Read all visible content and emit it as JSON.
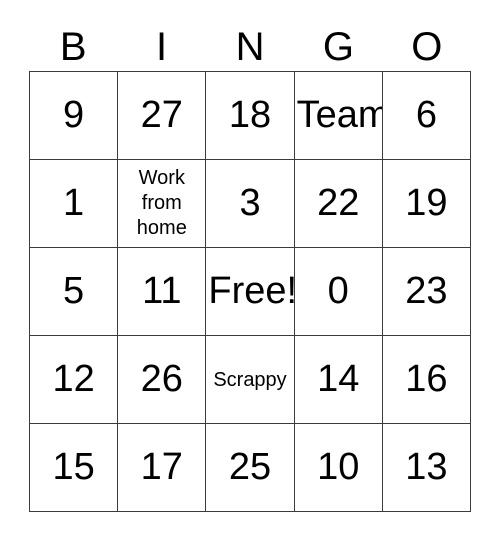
{
  "card": {
    "title": "BINGO",
    "headers": [
      "B",
      "I",
      "N",
      "G",
      "O"
    ],
    "free_space_label": "Free!",
    "colors": {
      "border": "#3b3b3b",
      "text": "#000000",
      "background": "#ffffff"
    },
    "rows": [
      [
        {
          "text": "9",
          "size": "large"
        },
        {
          "text": "27",
          "size": "large"
        },
        {
          "text": "18",
          "size": "large"
        },
        {
          "text": "Team",
          "size": "large"
        },
        {
          "text": "6",
          "size": "large"
        }
      ],
      [
        {
          "text": "1",
          "size": "large"
        },
        {
          "text": "Work\nfrom\nhome",
          "size": "small"
        },
        {
          "text": "3",
          "size": "large"
        },
        {
          "text": "22",
          "size": "large"
        },
        {
          "text": "19",
          "size": "large"
        }
      ],
      [
        {
          "text": "5",
          "size": "large"
        },
        {
          "text": "11",
          "size": "large"
        },
        {
          "text": "Free!",
          "size": "large"
        },
        {
          "text": "0",
          "size": "large"
        },
        {
          "text": "23",
          "size": "large"
        }
      ],
      [
        {
          "text": "12",
          "size": "large"
        },
        {
          "text": "26",
          "size": "large"
        },
        {
          "text": "Scrappy",
          "size": "medium"
        },
        {
          "text": "14",
          "size": "large"
        },
        {
          "text": "16",
          "size": "large"
        }
      ],
      [
        {
          "text": "15",
          "size": "large"
        },
        {
          "text": "17",
          "size": "large"
        },
        {
          "text": "25",
          "size": "large"
        },
        {
          "text": "10",
          "size": "large"
        },
        {
          "text": "13",
          "size": "large"
        }
      ]
    ]
  }
}
